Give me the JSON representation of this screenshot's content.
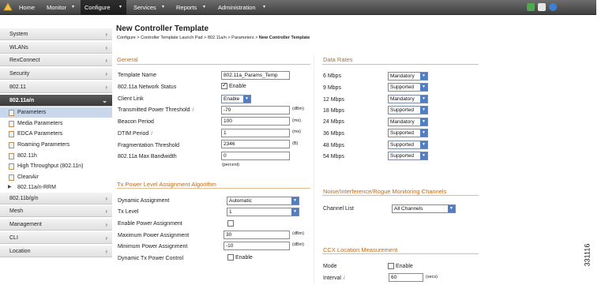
{
  "nav": {
    "items": [
      {
        "label": "Home"
      },
      {
        "label": "Monitor"
      },
      {
        "label": "Configure"
      },
      {
        "label": "Services"
      },
      {
        "label": "Reports"
      },
      {
        "label": "Administration"
      }
    ],
    "arrow": "▾"
  },
  "sidebar": {
    "items": [
      {
        "label": "System"
      },
      {
        "label": "WLANs"
      },
      {
        "label": "RexConnect"
      },
      {
        "label": "Security"
      },
      {
        "label": "802.11"
      },
      {
        "label": "802.11a/n"
      },
      {
        "label": "802.11b/g/n"
      },
      {
        "label": "Mesh"
      },
      {
        "label": "Management"
      },
      {
        "label": "CLI"
      },
      {
        "label": "Location"
      }
    ],
    "subitems": [
      {
        "label": "Parameters"
      },
      {
        "label": "Media Parameters"
      },
      {
        "label": "EDCA Parameters"
      },
      {
        "label": "Roaming Parameters"
      },
      {
        "label": "802.11h"
      },
      {
        "label": "High Throughput (802.11n)"
      },
      {
        "label": "CleanAir"
      },
      {
        "label": "802.11a/n-RRM"
      }
    ]
  },
  "page": {
    "title": "New Controller Template",
    "breadcrumb": {
      "trail": "Configure >  Controller Template Launch Pad >  802.11a/n >  Parameters >",
      "current": "New Controller Template"
    }
  },
  "general": {
    "title": "General",
    "template_name_label": "Template Name",
    "template_name_value": "802.11a_Params_Temp",
    "network_status_label": "802.11a Network Status",
    "network_status_checkbox": "Enable",
    "client_link_label": "Client Link",
    "client_link_value": "Enable",
    "tx_power_label": "Transmitted Power Threshold",
    "tx_power_value": "-70",
    "tx_power_unit": "(dBm)",
    "beacon_label": "Beacon Period",
    "beacon_value": "100",
    "beacon_unit": "(ms)",
    "dtim_label": "DTIM Period",
    "dtim_value": "1",
    "dtim_unit": "(ms)",
    "frag_label": "Fragmentation Threshold",
    "frag_value": "2346",
    "frag_unit": "(B)",
    "max_bw_label": "802.11a Max Bandwidth",
    "max_bw_value": "0",
    "max_bw_unit": "(percent)",
    "help_mark": "i"
  },
  "tpc": {
    "title": "Tx Power Level Assignment Algorithm",
    "dynamic_label": "Dynamic Assignment",
    "dynamic_value": "Automatic",
    "tx_level_label": "Tx Level",
    "tx_level_value": "1",
    "enable_power_label": "Enable Power Assignment",
    "max_power_label": "Maximum Power Assignment",
    "max_power_value": "30",
    "max_power_unit": "(dBm)",
    "min_power_label": "Minimum Power Assignment",
    "min_power_value": "-10",
    "min_power_unit": "(dBm)",
    "dyn_tx_label": "Dynamic Tx Power Control",
    "dyn_tx_checkbox": "Enable"
  },
  "data_rates": {
    "title": "Data Rates",
    "rates": [
      {
        "label": "6 Mbps",
        "value": "Mandatory"
      },
      {
        "label": "9 Mbps",
        "value": "Supported"
      },
      {
        "label": "12 Mbps",
        "value": "Mandatory"
      },
      {
        "label": "18 Mbps",
        "value": "Supported"
      },
      {
        "label": "24 Mbps",
        "value": "Mandatory"
      },
      {
        "label": "36 Mbps",
        "value": "Supported"
      },
      {
        "label": "48 Mbps",
        "value": "Supported"
      },
      {
        "label": "54 Mbps",
        "value": "Supported"
      }
    ]
  },
  "noise": {
    "title": "Noise/Interference/Rogue Monitoring Channels",
    "channel_label": "Channel List",
    "channel_value": "All Channels"
  },
  "ccx": {
    "title": "CCX Location Measurement",
    "mode_label": "Mode",
    "mode_checkbox": "Enable",
    "interval_label": "Interval",
    "interval_value": "60",
    "interval_unit": "(secs)"
  },
  "figure_number": "331116"
}
